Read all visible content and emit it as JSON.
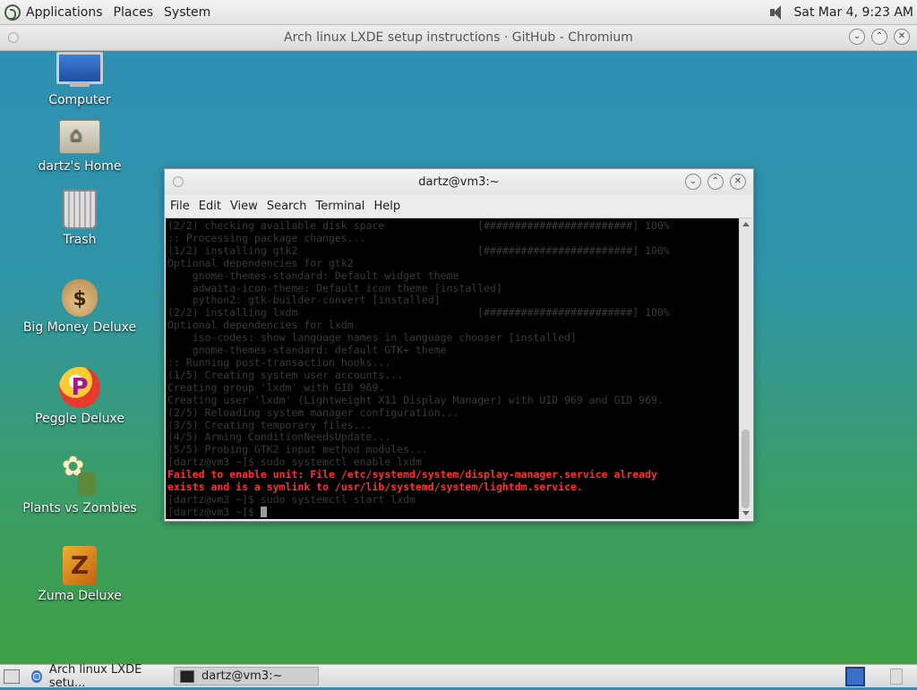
{
  "top_panel": {
    "menus": [
      "Applications",
      "Places",
      "System"
    ],
    "clock": "Sat Mar  4,  9:23 AM",
    "icons": [
      "distro-logo-icon",
      "speaker-icon"
    ]
  },
  "browser_window": {
    "title": "Arch linux LXDE setup instructions · GitHub - Chromium"
  },
  "desktop_icons": [
    {
      "label": "Computer",
      "icon": "computer-icon"
    },
    {
      "label": "dartz's Home",
      "icon": "home-folder-icon"
    },
    {
      "label": "Trash",
      "icon": "trash-icon"
    },
    {
      "label": "Big Money Deluxe",
      "icon": "money-bag-icon"
    },
    {
      "label": "Peggle Deluxe",
      "icon": "peggle-icon"
    },
    {
      "label": "Plants vs Zombies",
      "icon": "plant-icon"
    },
    {
      "label": "Zuma Deluxe",
      "icon": "zuma-icon"
    }
  ],
  "terminal": {
    "title": "dartz@vm3:~",
    "menu": [
      "File",
      "Edit",
      "View",
      "Search",
      "Terminal",
      "Help"
    ],
    "lines": [
      "(2/2) checking available disk space               [########################] 100%",
      ":: Processing package changes...",
      "(1/2) installing gtk2                             [########################] 100%",
      "Optional dependencies for gtk2",
      "    gnome-themes-standard: Default widget theme",
      "    adwaita-icon-theme: Default icon theme [installed]",
      "    python2: gtk-builder-convert [installed]",
      "(2/2) installing lxdm                             [########################] 100%",
      "Optional dependencies for lxdm",
      "    iso-codes: show language names in language chooser [installed]",
      "    gnome-themes-standard: default GTK+ theme",
      ":: Running post-transaction hooks...",
      "(1/5) Creating system user accounts...",
      "Creating group 'lxdm' with GID 969.",
      "Creating user 'lxdm' (Lightweight X11 Display Manager) with UID 969 and GID 969.",
      "(2/5) Reloading system manager configuration...",
      "(3/5) Creating temporary files...",
      "(4/5) Arming ConditionNeedsUpdate...",
      "(5/5) Probing GTK2 input method modules...",
      "[dartz@vm3 ~]$ sudo systemctl enable lxdm"
    ],
    "error_lines": [
      "Failed to enable unit: File /etc/systemd/system/display-manager.service already",
      "exists and is a symlink to /usr/lib/systemd/system/lightdm.service."
    ],
    "after_lines": [
      "[dartz@vm3 ~]$ sudo systemctl start lxdm",
      "[dartz@vm3 ~]$ "
    ]
  },
  "taskbar": {
    "tasks": [
      {
        "label": "Arch linux LXDE setu...",
        "icon": "chromium-icon"
      },
      {
        "label": "dartz@vm3:~",
        "icon": "terminal-icon"
      }
    ]
  }
}
